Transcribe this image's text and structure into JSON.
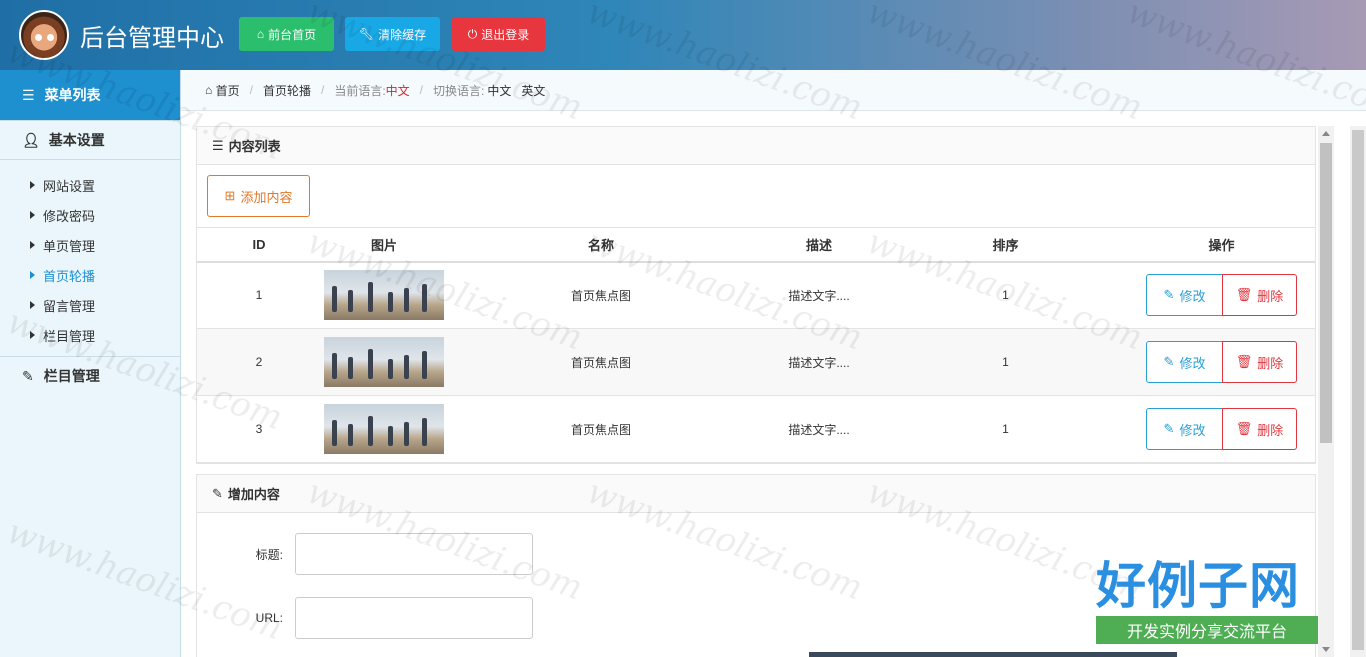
{
  "header": {
    "title": "后台管理中心",
    "buttons": {
      "home": "前台首页",
      "cache": "清除缓存",
      "logout": "退出登录"
    }
  },
  "sidebar": {
    "menu_title": "菜单列表",
    "section1": "基本设置",
    "items": [
      {
        "label": "网站设置"
      },
      {
        "label": "修改密码"
      },
      {
        "label": "单页管理"
      },
      {
        "label": "首页轮播"
      },
      {
        "label": "留言管理"
      },
      {
        "label": "栏目管理"
      }
    ],
    "section2": "栏目管理"
  },
  "breadcrumb": {
    "home": "首页",
    "current": "首页轮播",
    "lang_label": "当前语言:",
    "lang_value": "中文",
    "switch_label": "切换语言:",
    "switch_zh": "中文",
    "switch_en": "英文"
  },
  "list_panel": {
    "title": "内容列表",
    "add_button": "添加内容",
    "columns": [
      "ID",
      "图片",
      "名称",
      "描述",
      "排序",
      "操作"
    ],
    "rows": [
      {
        "id": "1",
        "name": "首页焦点图",
        "desc": "描述文字....",
        "order": "1"
      },
      {
        "id": "2",
        "name": "首页焦点图",
        "desc": "描述文字....",
        "order": "1"
      },
      {
        "id": "3",
        "name": "首页焦点图",
        "desc": "描述文字....",
        "order": "1"
      }
    ],
    "edit_label": "修改",
    "delete_label": "删除"
  },
  "add_panel": {
    "title": "增加内容",
    "fields": {
      "title_label": "标题:",
      "url_label": "URL:"
    }
  },
  "brand": {
    "big": "好例子网",
    "small": "开发实例分享交流平台"
  },
  "watermark": "www.haolizi.com"
}
